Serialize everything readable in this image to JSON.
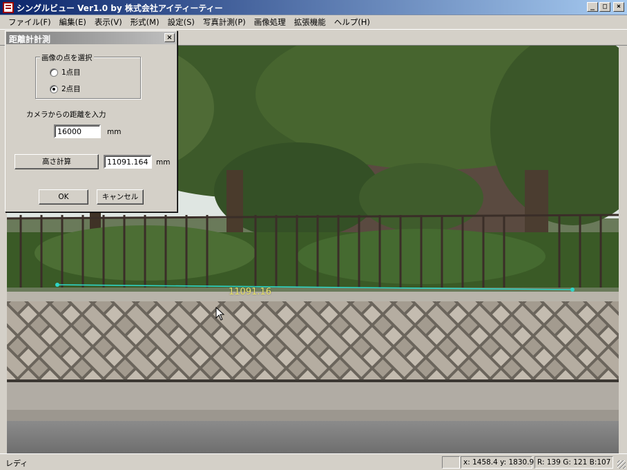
{
  "window": {
    "title": "シングルビュー  Ver1.0 by 株式会社アイティーティー",
    "min_label": "_",
    "max_label": "□",
    "close_label": "×"
  },
  "menu": [
    {
      "label": "ファイル(F)"
    },
    {
      "label": "編集(E)"
    },
    {
      "label": "表示(V)"
    },
    {
      "label": "形式(M)"
    },
    {
      "label": "設定(S)"
    },
    {
      "label": "写真計測(P)"
    },
    {
      "label": "画像処理"
    },
    {
      "label": "拡張機能"
    },
    {
      "label": "ヘルプ(H)"
    }
  ],
  "dialog": {
    "title": "距離計計測",
    "close_label": "×",
    "group_title": "画像の点を選択",
    "radio_point1": "1点目",
    "radio_point2": "2点目",
    "selected_point": 2,
    "distance_label": "カメラからの距離を入力",
    "distance_value": "16000",
    "distance_unit": "mm",
    "calc_button": "高さ計算",
    "result_value": "11091.16445",
    "result_unit": "mm",
    "ok_button": "OK",
    "cancel_button": "キャンセル"
  },
  "image": {
    "measure_label": "11091.16",
    "measure_line_color": "#2fd6c8",
    "measure_label_color": "#e9e26a"
  },
  "status": {
    "text": "レディ",
    "coords": "x: 1458.4 y: 1830.9",
    "rgb": "R: 139 G: 121  B:107"
  }
}
